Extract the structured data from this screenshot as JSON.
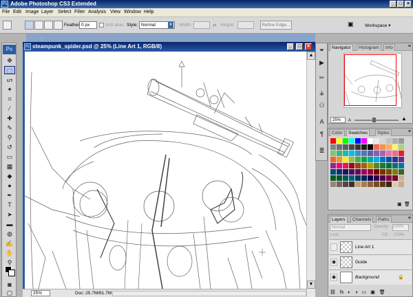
{
  "app": {
    "title": "Adobe Photoshop CS3 Extended",
    "logo": "Ps"
  },
  "menu": [
    "File",
    "Edit",
    "Image",
    "Layer",
    "Select",
    "Filter",
    "Analysis",
    "View",
    "Window",
    "Help"
  ],
  "options": {
    "feather_label": "Feather:",
    "feather_value": "0 px",
    "antialias_label": "Anti-alias",
    "style_label": "Style:",
    "style_value": "Normal",
    "width_label": "Width:",
    "height_label": "Height:",
    "refine_label": "Refine Edge...",
    "workspace_label": "Workspace"
  },
  "document": {
    "background_title": "...",
    "title": "steampunk_spider.psd @ 25% (Line Art 1, RGB/8)",
    "zoom": "25%",
    "doc_size": "Doc: 25.7M/81.7M"
  },
  "navigator": {
    "tabs": [
      "Navigator",
      "Histogram",
      "Info"
    ],
    "zoom": "25%"
  },
  "swatches": {
    "tabs": [
      "Color",
      "Swatches",
      "Styles"
    ],
    "colors": [
      "#ff0000",
      "#ffff00",
      "#00ff00",
      "#00ffff",
      "#0000ff",
      "#ff00ff",
      "#ffffff",
      "#ebebeb",
      "#d6d6d6",
      "#c2c2c2",
      "#adadad",
      "#999999",
      "#858585",
      "#707070",
      "#5c5c5c",
      "#474747",
      "#333333",
      "#1f1f1f",
      "#000000",
      "#f26c4f",
      "#f68e55",
      "#fbaf5c",
      "#fff467",
      "#acd372",
      "#7cc576",
      "#3bb878",
      "#1abbb4",
      "#00bff3",
      "#438ccb",
      "#5574b9",
      "#605ca8",
      "#855fa8",
      "#a763a8",
      "#f06ea9",
      "#f26d7d",
      "#ed1c24",
      "#f26522",
      "#f7941d",
      "#fff200",
      "#8dc73f",
      "#39b54a",
      "#00a651",
      "#00a99d",
      "#00aeef",
      "#0072bc",
      "#0054a6",
      "#2e3192",
      "#662d91",
      "#92278f",
      "#ec008c",
      "#ed145b",
      "#9e0b0f",
      "#a0410d",
      "#a36209",
      "#aba000",
      "#598527",
      "#1a7b30",
      "#007236",
      "#00746b",
      "#0076a3",
      "#004b80",
      "#003471",
      "#1b1464",
      "#440e62",
      "#630460",
      "#9e005d",
      "#9e0039",
      "#790000",
      "#7b2e00",
      "#7d4900",
      "#827b00",
      "#406618",
      "#005e20",
      "#005826",
      "#005952",
      "#005b7f",
      "#003663",
      "#002157",
      "#0d004c",
      "#32004b",
      "#4b0049",
      "#7b0046",
      "#7a0026",
      "#c7b299",
      "#998675",
      "#736357",
      "#534741",
      "#37302d",
      "#c69c6d",
      "#a67c52",
      "#8c6239",
      "#754c24",
      "#603913",
      "#3c2415",
      "#e5c7b0",
      "#c9a88e"
    ]
  },
  "layers": {
    "tabs": [
      "Layers",
      "Channels",
      "Paths"
    ],
    "blend_mode": "Normal",
    "opacity_label": "Opacity:",
    "opacity_value": "100%",
    "lock_label": "Lock:",
    "fill_label": "Fill:",
    "fill_value": "100%",
    "items": [
      {
        "name": "Line Art 1",
        "visible": false
      },
      {
        "name": "Guide",
        "visible": true
      },
      {
        "name": "Background",
        "visible": true
      }
    ]
  }
}
